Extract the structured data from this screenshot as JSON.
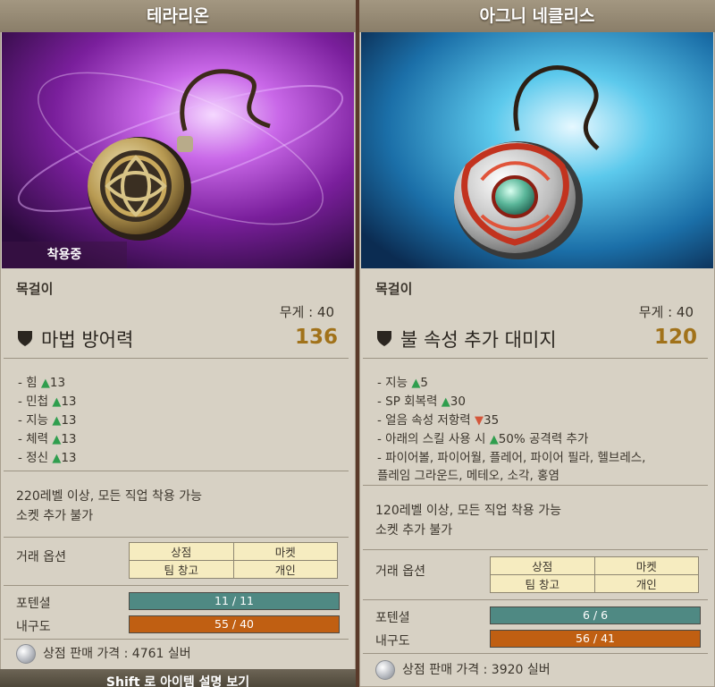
{
  "items": [
    {
      "title": "테라리온",
      "equipped_badge": "착용중",
      "type": "목걸이",
      "weight": "무게 : 40",
      "main_stat": {
        "name": "마법 방어력",
        "value": "136"
      },
      "bonuses": [
        {
          "label": "- 힘",
          "dir": "up",
          "arrow": "▲",
          "value": "13"
        },
        {
          "label": "- 민첩",
          "dir": "up",
          "arrow": "▲",
          "value": "13"
        },
        {
          "label": "- 지능",
          "dir": "up",
          "arrow": "▲",
          "value": "13"
        },
        {
          "label": "- 체력",
          "dir": "up",
          "arrow": "▲",
          "value": "13"
        },
        {
          "label": "- 정신",
          "dir": "up",
          "arrow": "▲",
          "value": "13"
        }
      ],
      "requirement": "220레벨 이상, 모든 직업 착용 가능",
      "socket": "소켓 추가 불가",
      "trade_label": "거래 옵션",
      "trade_options": [
        "상점",
        "마켓",
        "팀 창고",
        "개인"
      ],
      "potential_label": "포텐셜",
      "potential": "11 / 11",
      "durability_label": "내구도",
      "durability": "55 / 40",
      "price": "상점 판매 가격 : 4761 실버",
      "footer": "Shift 로 아이템 설명 보기"
    },
    {
      "title": "아그니 네클리스",
      "type": "목걸이",
      "weight": "무게 : 40",
      "main_stat": {
        "name": "불 속성 추가 대미지",
        "value": "120"
      },
      "bonuses": [
        {
          "label": "- 지능",
          "dir": "up",
          "arrow": "▲",
          "value": "5"
        },
        {
          "label": "- SP 회복력",
          "dir": "up",
          "arrow": "▲",
          "value": "30"
        },
        {
          "label": "- 얼음 속성 저항력",
          "dir": "down",
          "arrow": "▼",
          "value": "35"
        },
        {
          "label": "- 아래의 스킬 사용 시",
          "dir": "up",
          "arrow": "▲",
          "value": "50% 공격력 추가"
        },
        {
          "label": "- 파이어볼, 파이어월, 플레어, 파이어 필라, 헬브레스,",
          "dir": "",
          "arrow": "",
          "value": ""
        },
        {
          "label": "플레임 그라운드, 메테오, 소각, 홍염",
          "dir": "",
          "arrow": "",
          "value": ""
        }
      ],
      "requirement": "120레벨 이상, 모든 직업 착용 가능",
      "socket": "소켓 추가 불가",
      "trade_label": "거래 옵션",
      "trade_options": [
        "상점",
        "마켓",
        "팀 창고",
        "개인"
      ],
      "potential_label": "포텐셜",
      "potential": "6 / 6",
      "durability_label": "내구도",
      "durability": "56 / 41",
      "price": "상점 판매 가격 : 3920 실버"
    }
  ],
  "colors": {
    "potential_bar": "#4f8983",
    "durability_bar": "#c05f12",
    "stat_value": "#a1721a",
    "up_arrow": "#2f9e4e",
    "down_arrow": "#d4563a"
  },
  "icons": {
    "left_art": "terarion-necklace-image",
    "right_art": "agni-necklace-image",
    "stat": "shield-icon",
    "price": "silver-coin-icon"
  }
}
